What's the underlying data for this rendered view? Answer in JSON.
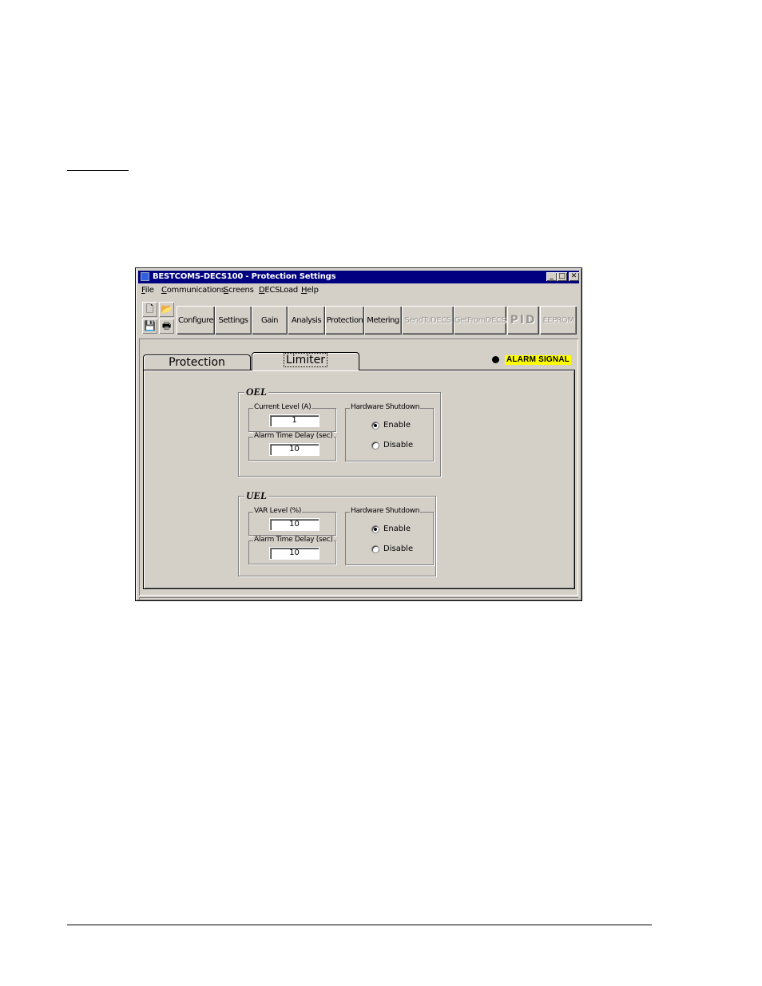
{
  "window": {
    "title": "BESTCOMS-DECS100 - Protection Settings"
  },
  "menu": [
    "File",
    "Communications",
    "Screens",
    "DECSLoad",
    "Help"
  ],
  "toolbar": {
    "buttons": [
      "Configure",
      "Settings",
      "Gain",
      "Analysis",
      "Protection",
      "Metering",
      "SendToDECS",
      "GetFromDECS",
      "PID",
      "EEPROM"
    ]
  },
  "tabs": [
    "Protection",
    "Limiter"
  ],
  "alarm": {
    "label": "ALARM SIGNAL"
  },
  "oel": {
    "title": "OEL",
    "current_level_label": "Current Level (A)",
    "current_level_value": "1",
    "delay_label": "Alarm Time Delay (sec)",
    "delay_value": "10",
    "shutdown_label": "Hardware Shutdown",
    "enable_label": "Enable",
    "disable_label": "Disable"
  },
  "uel": {
    "title": "UEL",
    "var_level_label": "VAR Level (%)",
    "var_level_value": "10",
    "delay_label": "Alarm Time Delay (sec)",
    "delay_value": "10",
    "shutdown_label": "Hardware Shutdown",
    "enable_label": "Enable",
    "disable_label": "Disable"
  },
  "colors": {
    "titlebar": "#000080",
    "window": "#d4d0c8",
    "alarm_highlight": "#ffff00"
  }
}
